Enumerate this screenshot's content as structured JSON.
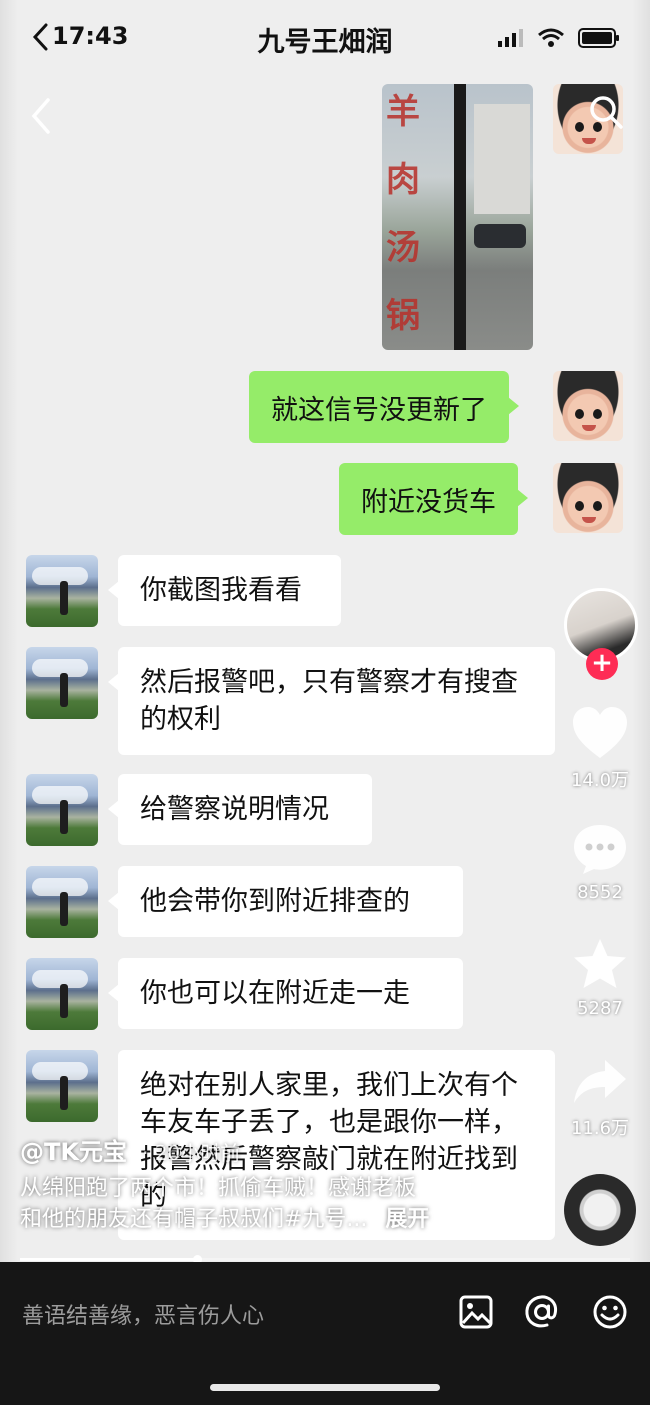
{
  "status_bar": {
    "time": "17:43",
    "title": "九号王畑润"
  },
  "messages": {
    "sent": [
      "就这信号没更新了",
      "附近没货车"
    ],
    "received": [
      "你截图我看看",
      "然后报警吧，只有警察才有搜查的权利",
      "给警察说明情况",
      "他会带你到附近排查的",
      "你也可以在附近走一走",
      "绝对在别人家里，我们上次有个车友车子丢了，也是跟你一样，报警然后警察敲门就在附近找到的"
    ],
    "photo_sign_chars": [
      "羊",
      "肉",
      "汤",
      "锅"
    ]
  },
  "rail": {
    "like_count": "14.0万",
    "comment_count": "8552",
    "favorite_count": "5287",
    "share_count": "11.6万",
    "follow_symbol": "+"
  },
  "caption": {
    "author": "@TK元宝",
    "time": "· 20小时前",
    "desc_line1": "从绵阳跑了两个市！抓偷车贼！感谢老板",
    "desc_line2": "和他的朋友还有帽子叔叔们#九号...",
    "expand": "展开"
  },
  "playback": {
    "progress": 0.29
  },
  "comment_bar": {
    "placeholder": "善语结善缘，恶言伤人心",
    "icons": [
      "image-icon",
      "at-icon",
      "emoji-icon"
    ]
  },
  "colors": {
    "sent_bubble": "#95ec69",
    "follow_badge": "#fe2c55"
  }
}
